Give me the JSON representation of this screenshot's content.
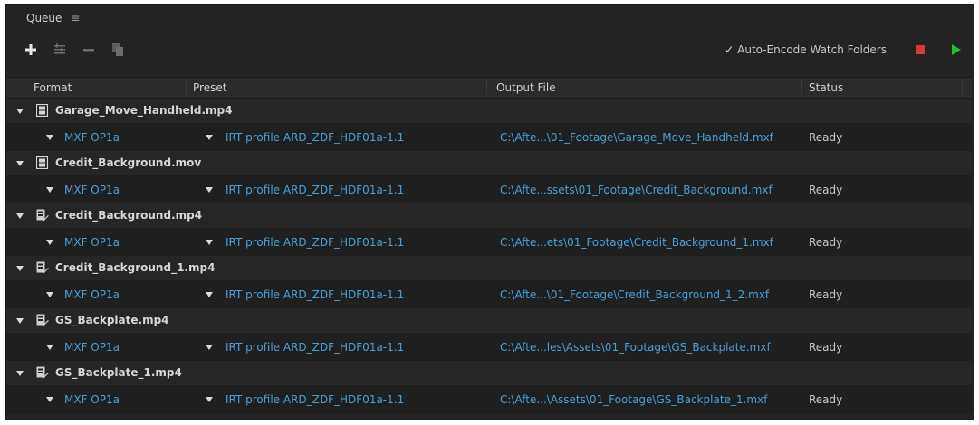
{
  "panel": {
    "title": "Queue",
    "menu_glyph": "≡"
  },
  "toolbar": {
    "add_icon": "plus-icon",
    "settings_icon": "list-settings-icon",
    "remove_icon": "minus-icon",
    "duplicate_icon": "duplicate-icon",
    "auto_encode_label": "Auto-Encode Watch Folders",
    "auto_encode_checked": true,
    "stop_color": "#d43a3a",
    "start_color": "#1fc03a"
  },
  "columns": {
    "format": "Format",
    "preset": "Preset",
    "output": "Output File",
    "status": "Status"
  },
  "items": [
    {
      "name": "Garage_Move_Handheld.mp4",
      "icon": "film-icon",
      "format": "MXF OP1a",
      "preset": "IRT profile ARD_ZDF_HDF01a-1.1",
      "output": "C:\\Afte...\\01_Footage\\Garage_Move_Handheld.mxf",
      "status": "Ready"
    },
    {
      "name": "Credit_Background.mov",
      "icon": "film-icon",
      "format": "MXF OP1a",
      "preset": "IRT profile ARD_ZDF_HDF01a-1.1",
      "output": "C:\\Afte...ssets\\01_Footage\\Credit_Background.mxf",
      "status": "Ready"
    },
    {
      "name": "Credit_Background.mp4",
      "icon": "clip-edit-icon",
      "format": "MXF OP1a",
      "preset": "IRT profile ARD_ZDF_HDF01a-1.1",
      "output": "C:\\Afte...ets\\01_Footage\\Credit_Background_1.mxf",
      "status": "Ready"
    },
    {
      "name": "Credit_Background_1.mp4",
      "icon": "clip-edit-icon",
      "format": "MXF OP1a",
      "preset": "IRT profile ARD_ZDF_HDF01a-1.1",
      "output": "C:\\Afte...\\01_Footage\\Credit_Background_1_2.mxf",
      "status": "Ready"
    },
    {
      "name": "GS_Backplate.mp4",
      "icon": "clip-edit-icon",
      "format": "MXF OP1a",
      "preset": "IRT profile ARD_ZDF_HDF01a-1.1",
      "output": "C:\\Afte...les\\Assets\\01_Footage\\GS_Backplate.mxf",
      "status": "Ready"
    },
    {
      "name": "GS_Backplate_1.mp4",
      "icon": "clip-edit-icon",
      "format": "MXF OP1a",
      "preset": "IRT profile ARD_ZDF_HDF01a-1.1",
      "output": "C:\\Afte...\\Assets\\01_Footage\\GS_Backplate_1.mxf",
      "status": "Ready"
    }
  ]
}
